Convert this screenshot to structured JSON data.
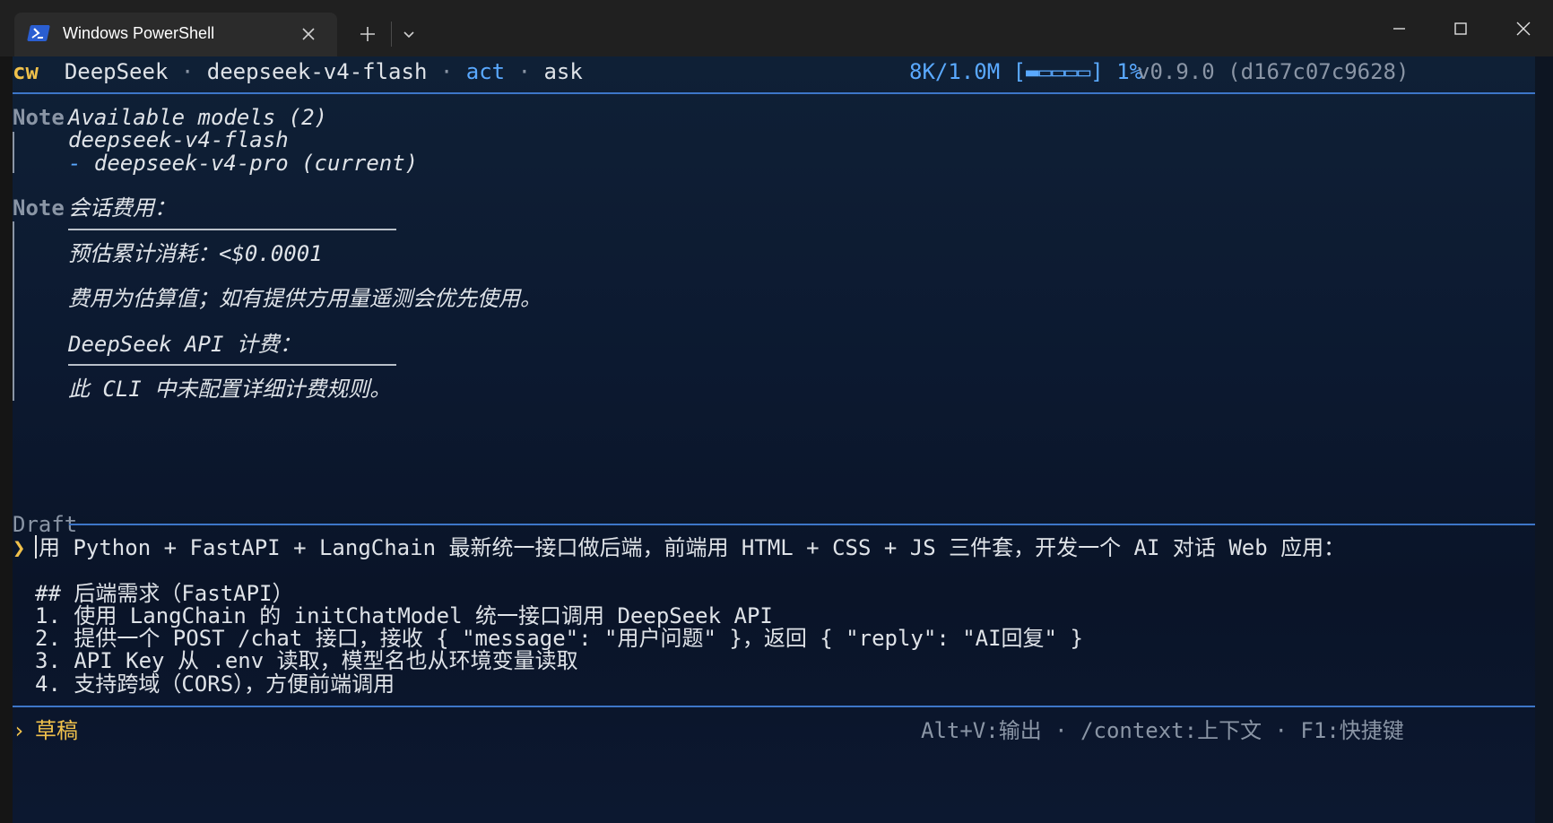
{
  "window": {
    "tab_title": "Windows PowerShell"
  },
  "status_bar": {
    "logo": "cw",
    "provider": "DeepSeek",
    "sep": "·",
    "model": "deepseek-v4-flash",
    "mode": "act",
    "submode": "ask",
    "context_usage": "8K/1.0M [▬▭▭▭▭] 1%",
    "version": "v0.9.0 (d167c07c9628)"
  },
  "notes": [
    {
      "label": "Note",
      "title": "Available models (2)",
      "lines": [
        "deepseek-v4-flash",
        "- deepseek-v4-pro (current)"
      ]
    },
    {
      "label": "Note",
      "title": "会话费用：",
      "cost_line": "预估累计消耗：<$0.0001",
      "estimate_note": "费用为估算值；如有提供方用量遥测会优先使用。",
      "billing_title": "DeepSeek API 计费：",
      "billing_note": "此 CLI 中未配置详细计费规则。"
    }
  ],
  "draft": {
    "label": "Draft",
    "prompt_symbol": "❯",
    "first_line": "用 Python + FastAPI + LangChain 最新统一接口做后端，前端用 HTML + CSS + JS 三件套，开发一个 AI 对话 Web 应用：",
    "lines": [
      "## 后端需求（FastAPI）",
      "1. 使用 LangChain 的 initChatModel 统一接口调用 DeepSeek API",
      "2. 提供一个 POST /chat 接口，接收 { \"message\": \"用户问题\" }，返回 { \"reply\": \"AI回复\" }",
      "3. API Key 从 .env 读取，模型名也从环境变量读取",
      "4. 支持跨域（CORS），方便前端调用"
    ]
  },
  "footer": {
    "prompt_symbol": "›",
    "mode_label": "草稿",
    "shortcuts": "Alt+V:输出 · /context:上下文 · F1:快捷键"
  },
  "colors": {
    "accent": "#5aa9ff",
    "logo": "#f0c14b",
    "divider": "#3d76c8",
    "terminal_bg": "#0c1930"
  }
}
